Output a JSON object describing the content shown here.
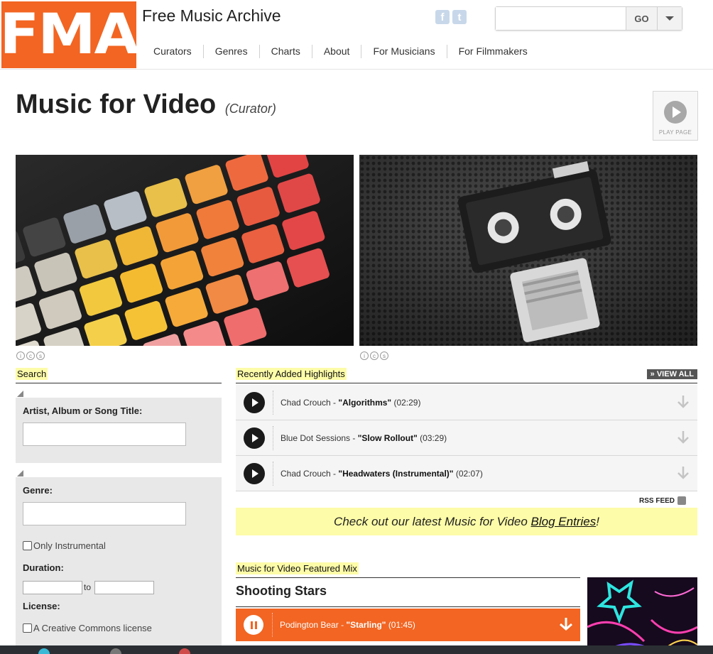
{
  "site": {
    "logo_text": "FMA",
    "title": "Free Music Archive",
    "social": [
      "facebook-icon",
      "twitter-icon"
    ],
    "search_placeholder": "",
    "search_button": "GO",
    "brand_color": "#f26522"
  },
  "nav": [
    "Curators",
    "Genres",
    "Charts",
    "About",
    "For Musicians",
    "For Filmmakers"
  ],
  "page": {
    "title": "Music for Video",
    "subtitle": "(Curator)",
    "play_page_label": "PLAY PAGE"
  },
  "search_panel": {
    "heading": "Search",
    "artist_label": "Artist, Album or Song Title:",
    "genre_label": "Genre:",
    "instrumental_label": "Only Instrumental",
    "duration_label": "Duration:",
    "duration_to": "to",
    "license_label": "License:",
    "cc_label": "A Creative Commons license"
  },
  "highlights": {
    "heading": "Recently Added Highlights",
    "view_all": "» VIEW ALL",
    "tracks": [
      {
        "artist": "Chad Crouch",
        "title": "\"Algorithms\"",
        "duration": "(02:29)"
      },
      {
        "artist": "Blue Dot Sessions",
        "title": "\"Slow Rollout\"",
        "duration": "(03:29)"
      },
      {
        "artist": "Chad Crouch",
        "title": "\"Headwaters (Instrumental)\"",
        "duration": "(02:07)"
      }
    ],
    "rss": "RSS FEED"
  },
  "blog": {
    "prefix": "Check out our latest Music for Video ",
    "link": "Blog Entries",
    "suffix": "!"
  },
  "featured_mix": {
    "heading": "Music for Video Featured Mix",
    "title": "Shooting Stars",
    "track": {
      "artist": "Podington Bear",
      "title": "\"Starling\"",
      "duration": "(01:45)"
    }
  }
}
